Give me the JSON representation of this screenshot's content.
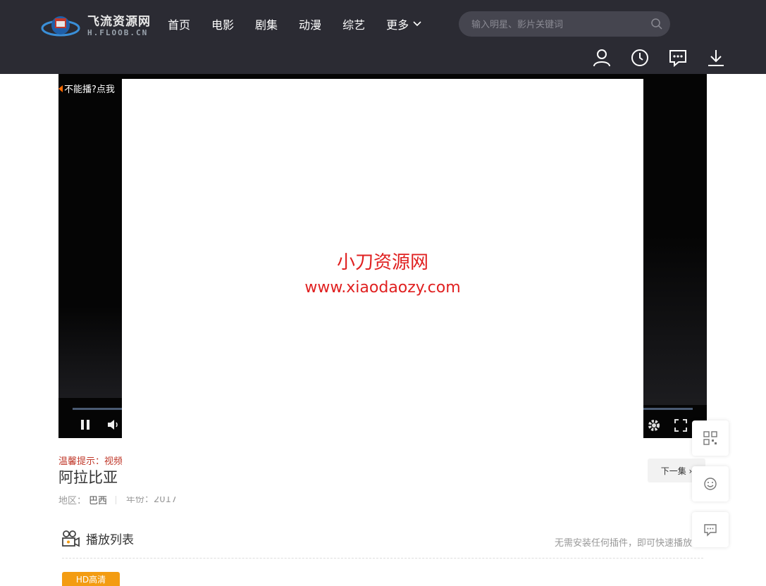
{
  "header": {
    "logo_title": "飞流资源网",
    "logo_domain": "H.FLOOB.CN",
    "nav": [
      {
        "label": "首页"
      },
      {
        "label": "电影"
      },
      {
        "label": "剧集"
      },
      {
        "label": "动漫"
      },
      {
        "label": "综艺"
      },
      {
        "label": "更多"
      }
    ],
    "search_placeholder": "输入明星、影片关键词",
    "icons": [
      "user-icon",
      "history-icon",
      "message-icon",
      "download-icon"
    ]
  },
  "player": {
    "cant_play": "不能播?点我",
    "progress": 0,
    "controls": [
      "pause-icon",
      "volume-icon",
      "settings-icon",
      "fullscreen-icon"
    ]
  },
  "ad": {
    "line1": "小刀资源网",
    "line2": "www.xiaodaozy.com"
  },
  "video": {
    "tip": "温馨提示：视频",
    "title": "阿拉比亚",
    "region_label": "地区：",
    "region_value": "巴西",
    "year_partial": "年份：2017",
    "next_label": "下一集 ›"
  },
  "playlist": {
    "label": "播放列表",
    "hint": "无需安装任何插件，即可快速播放",
    "source_label": "HD高清"
  },
  "float_icons": [
    "qrcode-icon",
    "smile-icon",
    "chat-icon"
  ],
  "colors": {
    "header_bg": "#2b2b33",
    "accent": "#f39c12",
    "ad_text": "#e02020",
    "tip_text": "#c0392b"
  }
}
